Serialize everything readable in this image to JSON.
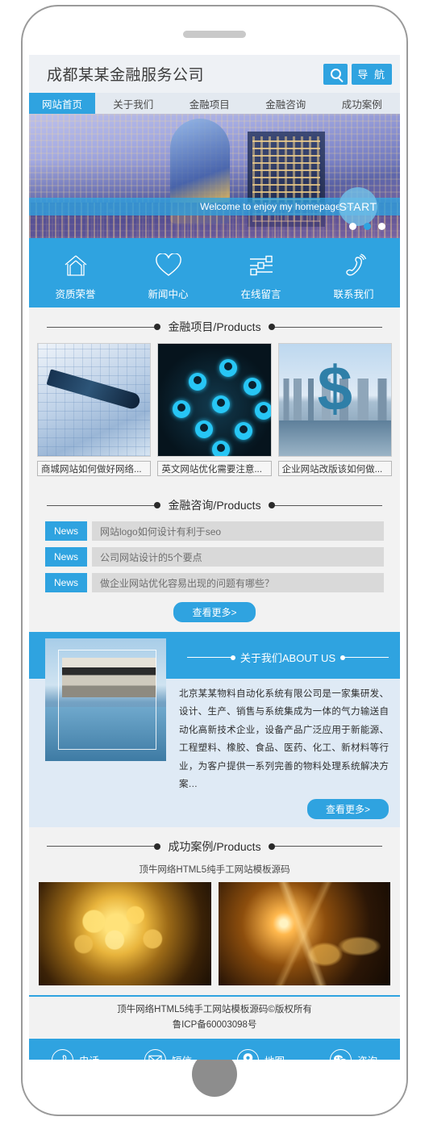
{
  "header": {
    "title": "成都某某金融服务公司",
    "search_icon": "search-icon",
    "nav_button": "导 航"
  },
  "nav_tabs": [
    {
      "label": "网站首页",
      "active": true
    },
    {
      "label": "关于我们",
      "active": false
    },
    {
      "label": "金融项目",
      "active": false
    },
    {
      "label": "金融咨询",
      "active": false
    },
    {
      "label": "成功案例",
      "active": false
    }
  ],
  "hero": {
    "welcome_text": "Welcome to enjoy my homepage >>",
    "start_label": "START",
    "dots": 3,
    "active_dot": 2
  },
  "quick_nav": [
    {
      "label": "资质荣誉",
      "icon": "home-outline-icon"
    },
    {
      "label": "新闻中心",
      "icon": "heart-outline-icon"
    },
    {
      "label": "在线留言",
      "icon": "sliders-icon"
    },
    {
      "label": "联系我们",
      "icon": "phone-ringing-icon"
    }
  ],
  "products": {
    "section_title": "金融项目/Products",
    "items": [
      {
        "caption": "商城网站如何做好网络..."
      },
      {
        "caption": "英文网站优化需要注意..."
      },
      {
        "caption": "企业网站改版该如何做..."
      }
    ]
  },
  "news": {
    "section_title": "金融咨询/Products",
    "tag": "News",
    "items": [
      {
        "title": "网站logo如何设计有利于seo"
      },
      {
        "title": "公司网站设计的5个要点"
      },
      {
        "title": "做企业网站优化容易出现的问题有哪些？"
      }
    ],
    "more_label": "查看更多>"
  },
  "about": {
    "section_title": "关于我们ABOUT US",
    "body": "北京某某物料自动化系统有限公司是一家集研发、设计、生产、销售与系统集成为一体的气力输送自动化高新技术企业，设备产品广泛应用于新能源、工程塑料、橡胶、食品、医药、化工、新材料等行业，为客户提供一系列完善的物料处理系统解决方案…",
    "more_label": "查看更多>"
  },
  "cases": {
    "section_title": "成功案例/Products",
    "subtitle": "顶牛网络HTML5纯手工网站模板源码"
  },
  "footer": {
    "copyright_line1": "顶牛网络HTML5纯手工网站模板源码©版权所有",
    "copyright_line2": "鲁ICP备60003098号",
    "bar": [
      {
        "label": "电话",
        "icon": "phone-icon"
      },
      {
        "label": "短信",
        "icon": "envelope-icon"
      },
      {
        "label": "地图",
        "icon": "map-pin-icon"
      },
      {
        "label": "咨询",
        "icon": "chat-bubbles-icon"
      }
    ]
  },
  "colors": {
    "brand_blue": "#2fa3e0",
    "header_bg": "#eef1f5",
    "page_bg": "#f2f2f2",
    "about_bg": "#dfeaf5",
    "news_row_bg": "#d9d9d9"
  }
}
